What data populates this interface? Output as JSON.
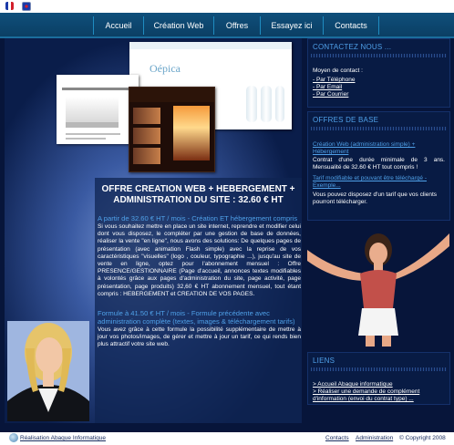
{
  "nav": {
    "items": [
      "Accueil",
      "Création Web",
      "Offres",
      "Essayez ici",
      "Contacts"
    ]
  },
  "offer": {
    "title": "OFFRE CREATION WEB + HEBERGEMENT + ADMINISTRATION DU SITE : 32.60 € HT",
    "subhead1": "A partir de 32.60 € HT / mois - Création ET hébergement compris",
    "para1": "Si vous souhaitez mettre en place un site internet, reprendre et modifier celui dont vous disposez, le compléter par une gestion de base de données, réaliser la vente \"en ligne\", nous avons des solutions: De quelques pages de présentation (avec animation Flash simple) avec la reprise de vos caractéristiques \"visuelles\" (logo , couleur, typographie ...), jusqu'au site de vente en ligne, optez pour l'abonnement mensuel : Offre PRESENCE/GESTIONNAIRE (Page d'accueil, annonces textes modifiables à volontés grâce aux pages d'administration du site, page activité, page présentation, page produits) 32,60 € HT abonnement mensuel, tout étant compris : HEBERGEMENT et CREATION DE VOS PAGES.",
    "subhead2": "Formule à 41.50 € HT / mois - Formule précédente avec administration complète (textes, images & téléchargement tarifs)",
    "para2": "Vous avez grâce à cette formule la possibilité supplémentaire de mettre à jour vos photos/images, de gérer et mettre à jour un tarif, ce qui rends bien plus attractif votre site web."
  },
  "screens": {
    "logo_text": "Oépica"
  },
  "contact": {
    "title": "CONTACTEZ NOUS ...",
    "intro": "Moyen de contact :",
    "links": [
      "- Par Téléphone",
      "- Par Email",
      "- Par Courrier"
    ]
  },
  "offres": {
    "title": "OFFRES DE BASE",
    "link1": "Création Web (administration simple) + Hébergement",
    "text1": "Contrat d'une durée minimale de 3 ans. Mensualité de 32.60 € HT tout compris !",
    "link2": "Tarif modifiable et pouvant être téléchargé - Exemple...",
    "text2": "Vous pouvez disposez d'un tarif que vos clients pourront télécharger."
  },
  "liens": {
    "title": "LIENS",
    "links": [
      "> Accueil Abaque informatique",
      "> Réaliser une demande de complément d'information (envoi du contrat type) ..."
    ]
  },
  "footer": {
    "left": "Réalisation Abaque Informatique",
    "contacts": "Contacts",
    "admin": "Administration",
    "copyright": "© Copyright 2008"
  },
  "colors": {
    "accent": "#4fa0e8",
    "background": "#0a1a3f",
    "navbar": "#0f4f7b"
  }
}
